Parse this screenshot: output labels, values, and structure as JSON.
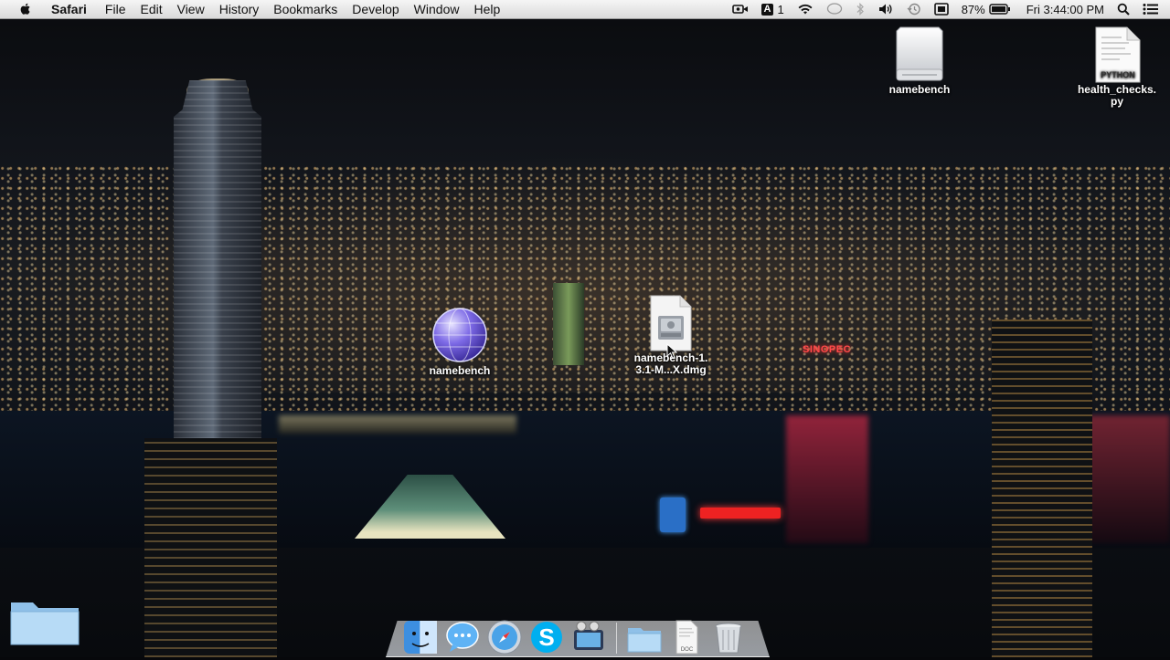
{
  "menubar": {
    "app_name": "Safari",
    "menus": [
      "File",
      "Edit",
      "View",
      "History",
      "Bookmarks",
      "Develop",
      "Window",
      "Help"
    ],
    "status": {
      "input_source": "A",
      "input_count": "1",
      "battery_percent": "87%",
      "clock": "Fri 3:44:00 PM"
    }
  },
  "desktop": {
    "icons": [
      {
        "name": "namebench",
        "kind": "drive"
      },
      {
        "name_line1": "health_checks.",
        "name_line2": "py",
        "kind": "python-file",
        "badge": "PYTHON"
      },
      {
        "name": "namebench",
        "kind": "app-globe"
      },
      {
        "name_line1": "namebench-1.",
        "name_line2": "3.1-M...X.dmg",
        "kind": "dmg-file"
      }
    ]
  },
  "wallpaper": {
    "signs": {
      "sinopec": "SINOPEC"
    }
  },
  "dock": {
    "items": [
      "finder-icon",
      "messages-icon",
      "safari-icon",
      "skype-icon",
      "imovie-icon",
      "folder-icon",
      "document-icon",
      "trash-icon"
    ],
    "doc_badge": "DOC"
  },
  "colors": {
    "menubar_bg": "#e6e6e6",
    "skype_blue": "#00aff0",
    "finder_blue": "#3d8fe0"
  }
}
